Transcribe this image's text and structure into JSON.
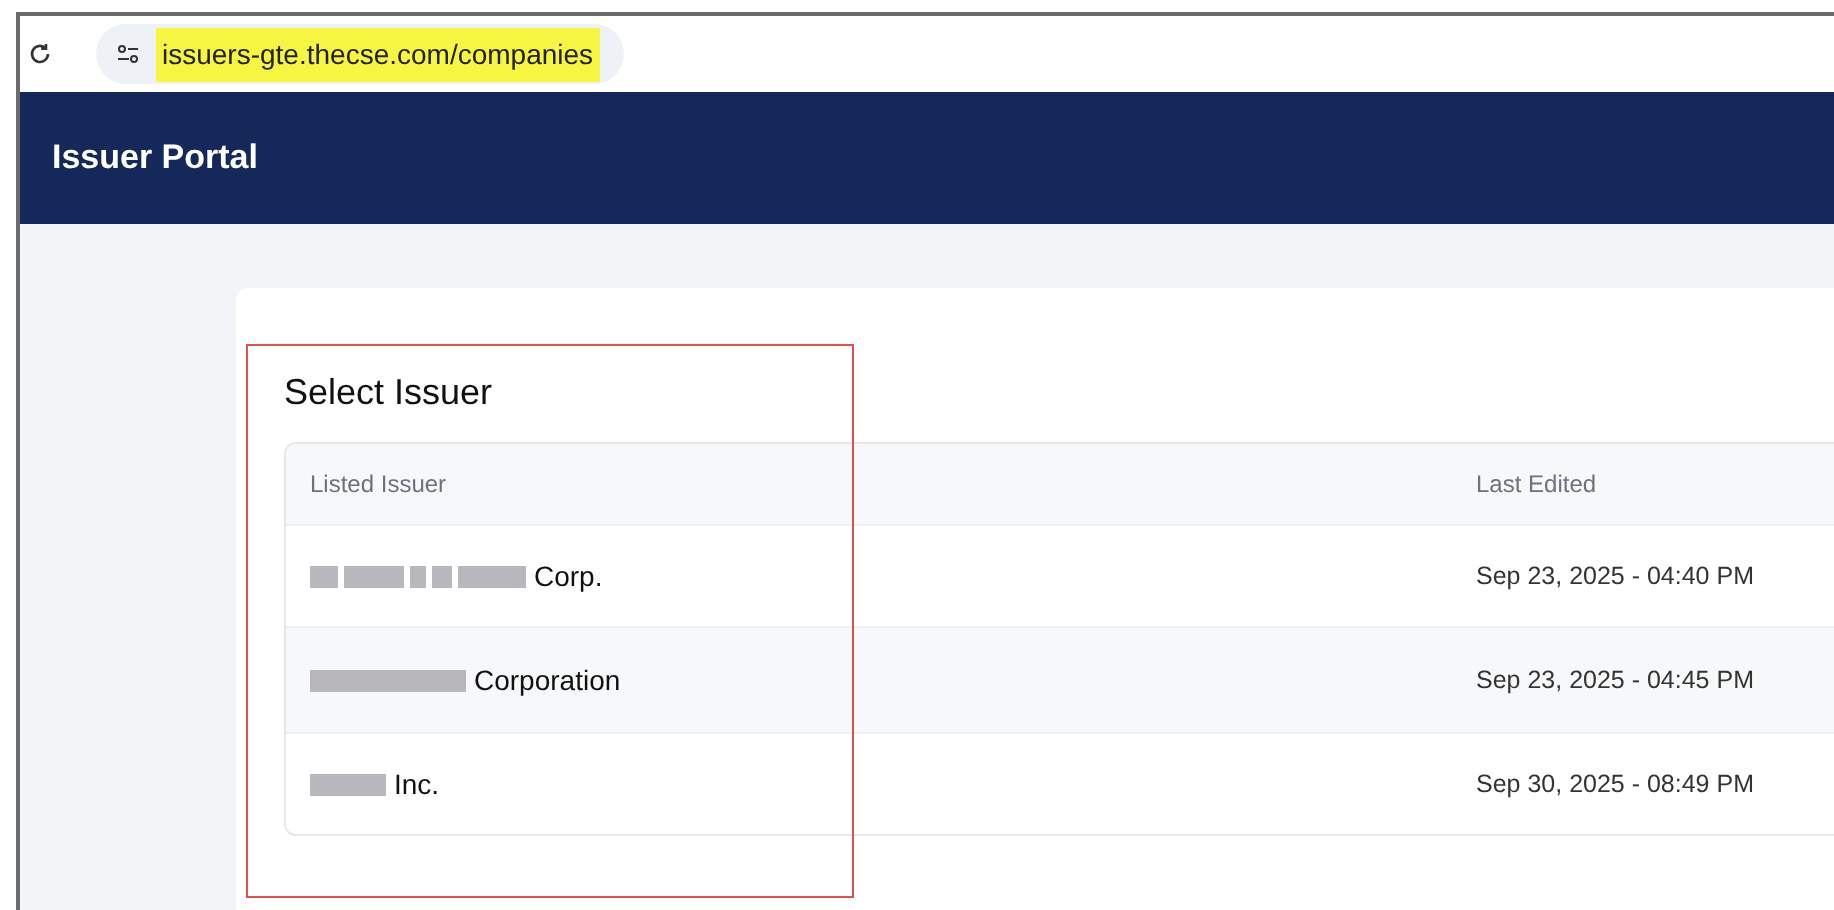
{
  "browser": {
    "url": "issuers-gte.thecse.com/companies"
  },
  "header": {
    "title": "Issuer Portal"
  },
  "card": {
    "title": "Select Issuer"
  },
  "table": {
    "columns": [
      "Listed Issuer",
      "Last Edited"
    ],
    "rows": [
      {
        "issuer": "Corp.",
        "last_edited": "Sep 23, 2025 - 04:40 PM"
      },
      {
        "issuer": "Corporation",
        "last_edited": "Sep 23, 2025 - 04:45 PM"
      },
      {
        "issuer": "Inc.",
        "last_edited": "Sep 30, 2025 - 08:49 PM"
      }
    ]
  }
}
